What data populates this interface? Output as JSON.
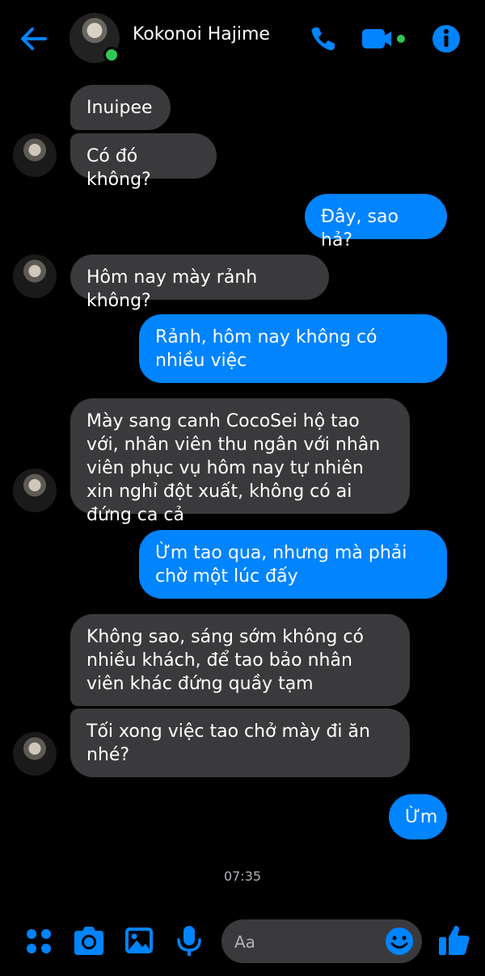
{
  "header": {
    "contact_name": "Kokonoi Hajime",
    "icons": [
      "back-arrow-icon",
      "phone-icon",
      "video-camera-icon",
      "info-icon"
    ]
  },
  "messages": [
    {
      "from": "contact",
      "text": "Inuipee"
    },
    {
      "from": "contact",
      "text": "Có đó không?"
    },
    {
      "from": "me",
      "text": "Đây, sao hả?"
    },
    {
      "from": "contact",
      "text": "Hôm nay mày rảnh không?"
    },
    {
      "from": "me",
      "text": "Rảnh, hôm nay không có nhiều việc"
    },
    {
      "from": "contact",
      "text": "Mày sang canh CocoSei hộ tao với, nhân viên thu ngân với nhân viên phục vụ hôm nay tự nhiên xin nghỉ đột xuất, không có ai đứng ca cả"
    },
    {
      "from": "me",
      "text": "Ừm tao qua, nhưng mà phải chờ một lúc đấy"
    },
    {
      "from": "contact",
      "text": "Không sao, sáng sớm không có nhiều khách, để tao bảo nhân viên khác đứng quầy tạm"
    },
    {
      "from": "contact",
      "text": "Tối xong việc tao chở mày đi ăn nhé?"
    },
    {
      "from": "me",
      "text": "Ừm"
    }
  ],
  "timestamp": "07:35",
  "composer": {
    "placeholder": "Aa",
    "icons": [
      "apps-grid-icon",
      "camera-icon",
      "gallery-icon",
      "microphone-icon",
      "emoji-icon",
      "thumbs-up-icon"
    ]
  },
  "colors": {
    "background": "#000000",
    "accent": "#0084ff",
    "incoming_bubble": "#3a3a3c",
    "online": "#30c754"
  }
}
